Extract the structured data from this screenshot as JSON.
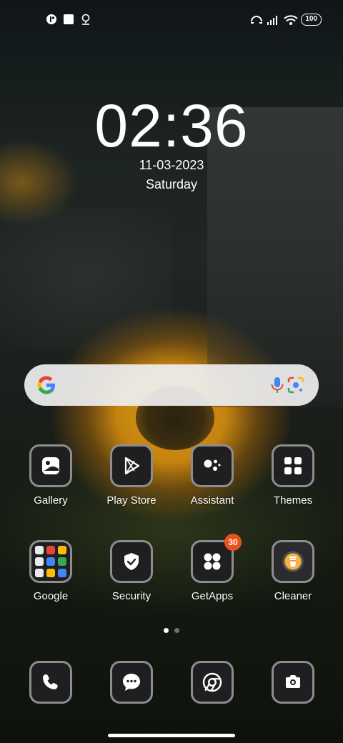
{
  "status_bar": {
    "left_icons": [
      "notification-icon",
      "square-icon",
      "location-pin-icon"
    ],
    "right_icons": [
      "hotspot-icon",
      "signal-icon",
      "wifi-icon"
    ],
    "battery": "100"
  },
  "clock": {
    "time": "02:36",
    "date": "11-03-2023",
    "day": "Saturday"
  },
  "search": {
    "icons": [
      "google-logo-icon",
      "mic-icon",
      "lens-icon"
    ]
  },
  "apps": {
    "row1": [
      {
        "label": "Gallery",
        "icon": "gallery-icon"
      },
      {
        "label": "Play Store",
        "icon": "play-store-icon"
      },
      {
        "label": "Assistant",
        "icon": "assistant-icon"
      },
      {
        "label": "Themes",
        "icon": "themes-icon"
      }
    ],
    "row2": [
      {
        "label": "Google",
        "icon": "google-folder-icon"
      },
      {
        "label": "Security",
        "icon": "shield-icon"
      },
      {
        "label": "GetApps",
        "icon": "getapps-icon",
        "badge": "30"
      },
      {
        "label": "Cleaner",
        "icon": "cleaner-icon"
      }
    ]
  },
  "page_indicator": {
    "pages": 2,
    "current": 1
  },
  "dock": [
    {
      "icon": "phone-icon"
    },
    {
      "icon": "messages-icon"
    },
    {
      "icon": "chrome-icon"
    },
    {
      "icon": "camera-icon"
    }
  ],
  "colors": {
    "badge": "#e9531e",
    "tile_bg": "#1f1f21",
    "tile_border": "#8d8d8f"
  }
}
